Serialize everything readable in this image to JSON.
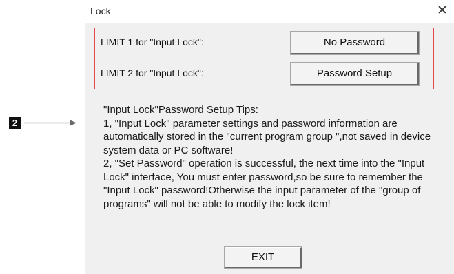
{
  "annotation": {
    "marker_label": "2"
  },
  "dialog": {
    "title": "Lock",
    "close_glyph": "✕",
    "limits": [
      {
        "label": "LIMIT 1 for \"Input Lock\":",
        "button": "No Password"
      },
      {
        "label": "LIMIT 2 for \"Input Lock\":",
        "button": "Password Setup"
      }
    ],
    "tips": [
      "\"Input Lock\"Password Setup Tips:",
      "1, \"Input Lock\" parameter settings and password information are automatically stored in the \"current program group \",not saved in device system data or PC software!",
      "2, \"Set Password\" operation is successful, the next time into the \"Input Lock\" interface, You must enter password,so be sure to remember the \"Input Lock\" password!Otherwise the input parameter of the \"group of programs\" will not be able to modify the lock item!"
    ],
    "exit_label": "EXIT"
  },
  "colors": {
    "highlight_border": "#e5484d",
    "dialog_bg": "#f0f0f0"
  }
}
